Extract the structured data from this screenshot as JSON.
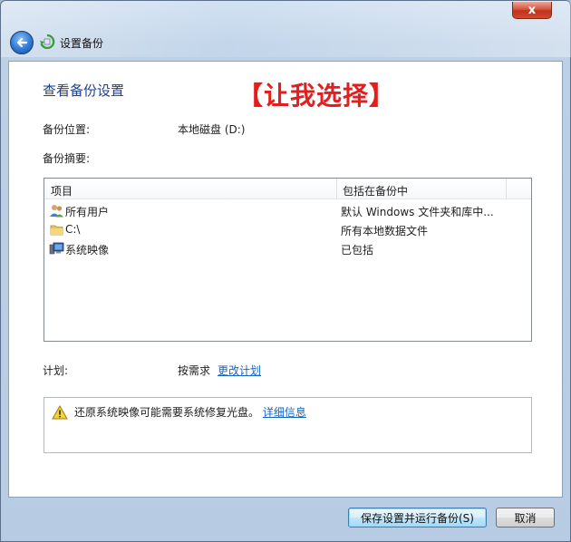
{
  "window": {
    "title": "设置备份",
    "close_glyph": "x"
  },
  "page": {
    "heading": "查看备份设置",
    "overlay_annotation": "【让我选择】"
  },
  "backup_location": {
    "label": "备份位置:",
    "value": "本地磁盘 (D:)"
  },
  "backup_summary": {
    "label": "备份摘要:"
  },
  "table": {
    "columns": [
      "项目",
      "包括在备份中"
    ],
    "rows": [
      {
        "name": "所有用户",
        "included": "默认 Windows 文件夹和库中...",
        "icon": "users-icon"
      },
      {
        "name": "C:\\",
        "included": "所有本地数据文件",
        "icon": "folder-icon"
      },
      {
        "name": "系统映像",
        "included": "已包括",
        "icon": "system-image-icon"
      }
    ]
  },
  "schedule": {
    "label": "计划:",
    "value": "按需求",
    "change_link": "更改计划"
  },
  "warning": {
    "text": "还原系统映像可能需要系统修复光盘。",
    "details_link": "详细信息",
    "icon": "warning-icon"
  },
  "buttons": {
    "save_run": "保存设置并运行备份(S)",
    "cancel": "取消"
  },
  "colors": {
    "heading": "#1e3f8c",
    "overlay": "#e31e1e",
    "link": "#1565c7"
  }
}
